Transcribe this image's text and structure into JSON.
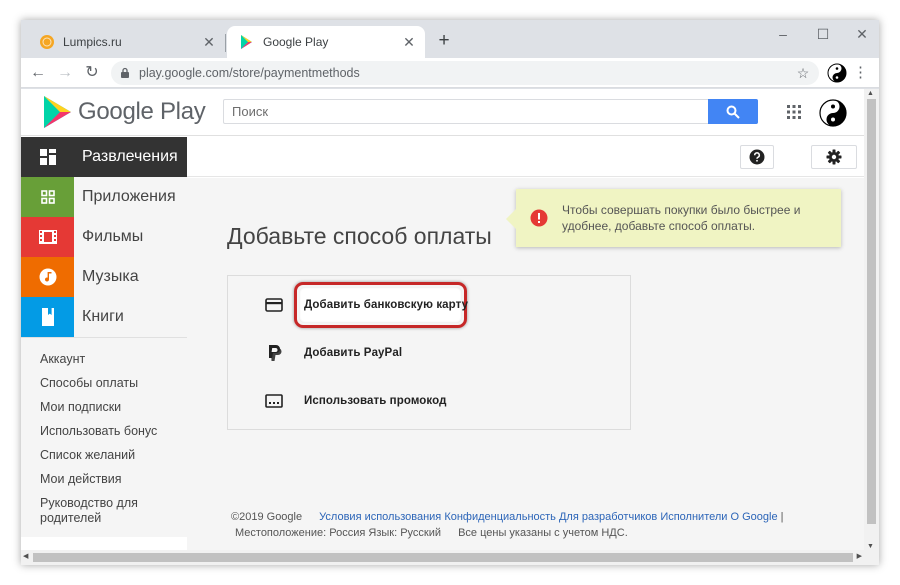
{
  "tabs": [
    {
      "title": "Lumpics.ru",
      "active": false
    },
    {
      "title": "Google Play",
      "active": true
    }
  ],
  "omnibox": {
    "url": "play.google.com/store/paymentmethods"
  },
  "header": {
    "logo_text": "Google Play",
    "search_placeholder": "Поиск"
  },
  "categories": [
    {
      "label": "Развлечения",
      "icon": "apps-grid-icon",
      "color": "#333333"
    },
    {
      "label": "Приложения",
      "icon": "android-apps-icon",
      "color": "#689f38"
    },
    {
      "label": "Фильмы",
      "icon": "film-icon",
      "color": "#e53935"
    },
    {
      "label": "Музыка",
      "icon": "music-note-icon",
      "color": "#ef6c00"
    },
    {
      "label": "Книги",
      "icon": "book-icon",
      "color": "#039be5"
    }
  ],
  "subnav": [
    "Аккаунт",
    "Способы оплаты",
    "Мои подписки",
    "Использовать бонус",
    "Список желаний",
    "Мои действия",
    "Руководство для родителей"
  ],
  "page": {
    "title": "Добавьте способ оплаты",
    "tooltip": "Чтобы совершать покупки было быстрее и удобнее, добавьте способ оплаты."
  },
  "payment_options": [
    {
      "label": "Добавить банковскую карту",
      "icon": "credit-card-icon",
      "highlighted": true
    },
    {
      "label": "Добавить PayPal",
      "icon": "paypal-icon"
    },
    {
      "label": "Использовать промокод",
      "icon": "promo-code-icon"
    }
  ],
  "footer": {
    "copyright": "©2019 Google",
    "links": [
      "Условия использования",
      "Конфиденциальность",
      "Для разработчиков",
      "Исполнители",
      "О Google"
    ],
    "separator": "|",
    "location": "Местоположение: Россия",
    "language": "Язык: Русский",
    "vat_note": "Все цены указаны с учетом НДС."
  },
  "colors": {
    "search_button": "#4285f4",
    "highlight_border": "#c62828",
    "tooltip_bg": "#f0f4c3",
    "link": "#2c65b8"
  }
}
